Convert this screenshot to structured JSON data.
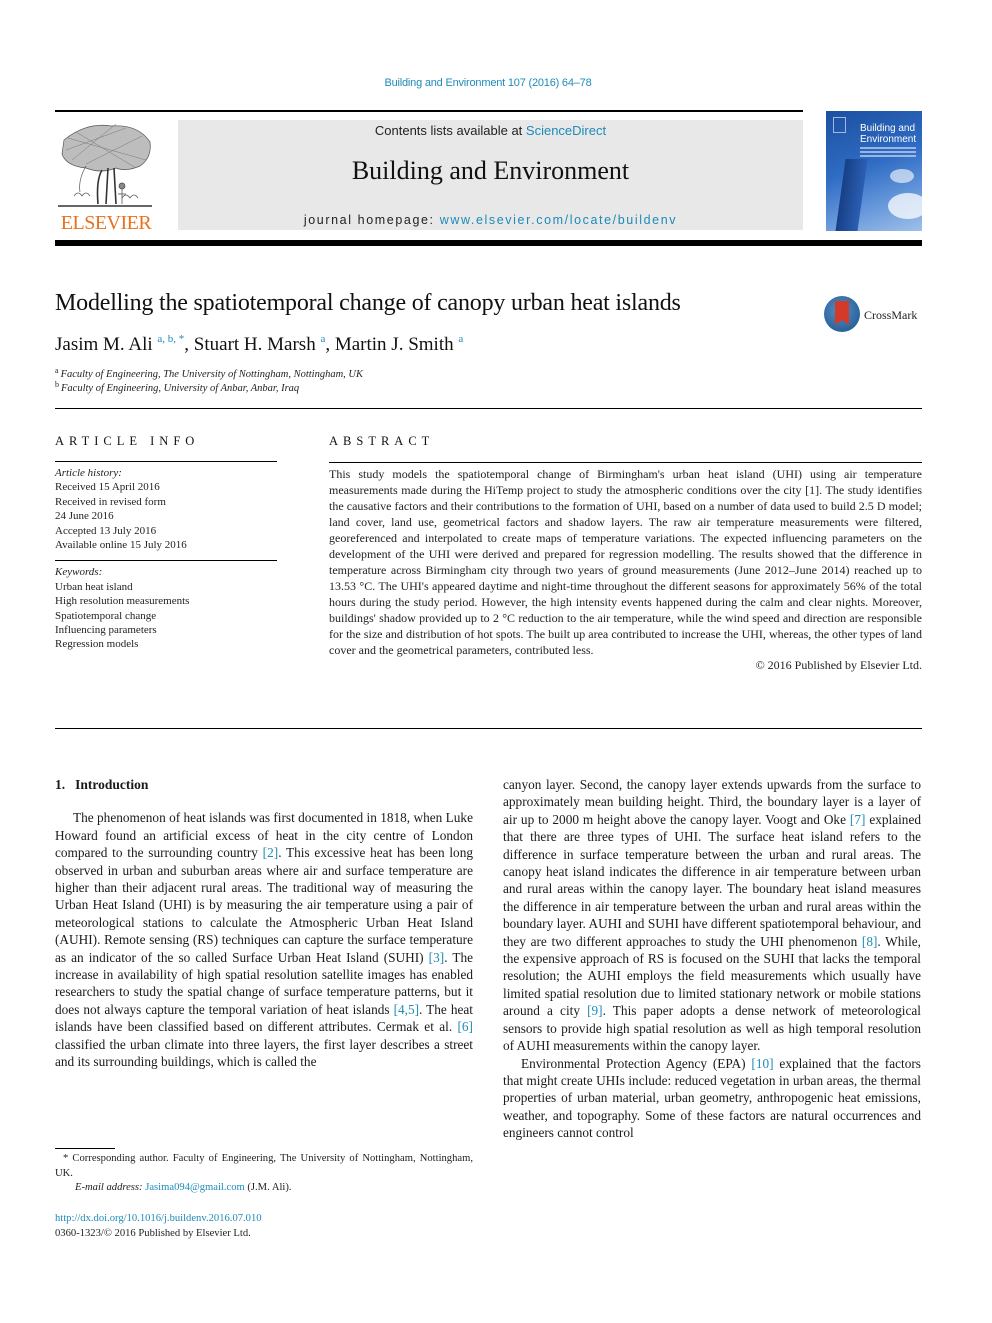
{
  "header": {
    "journal_ref": "Building and Environment 107 (2016) 64–78",
    "contents_prefix": "Contents lists available at ",
    "contents_link": "ScienceDirect",
    "journal_title": "Building and Environment",
    "homepage_prefix": "journal homepage: ",
    "homepage_link": "www.elsevier.com/locate/buildenv",
    "publisher_logo_text": "ELSEVIER",
    "cover_title_line1": "Building and",
    "cover_title_line2": "Environment",
    "colors": {
      "link": "#1f8ab8",
      "elsevier_orange": "#e9711c",
      "masthead_bg": "#e8e8e8"
    }
  },
  "article": {
    "title": "Modelling the spatiotemporal change of canopy urban heat islands",
    "crossmark_label": "CrossMark",
    "authors": [
      {
        "name": "Jasim M. Ali",
        "marks": "a, b, *",
        "sep": ", "
      },
      {
        "name": "Stuart H. Marsh",
        "marks": "a",
        "sep": ", "
      },
      {
        "name": "Martin J. Smith",
        "marks": "a",
        "sep": ""
      }
    ],
    "affiliations": [
      {
        "mark": "a",
        "text": "Faculty of Engineering, The University of Nottingham, Nottingham, UK"
      },
      {
        "mark": "b",
        "text": "Faculty of Engineering, University of Anbar, Anbar, Iraq"
      }
    ]
  },
  "article_info": {
    "heading": "ARTICLE INFO",
    "history_label": "Article history:",
    "history": [
      "Received 15 April 2016",
      "Received in revised form",
      "24 June 2016",
      "Accepted 13 July 2016",
      "Available online 15 July 2016"
    ],
    "keywords_label": "Keywords:",
    "keywords": [
      "Urban heat island",
      "High resolution measurements",
      "Spatiotemporal change",
      "Influencing parameters",
      "Regression models"
    ]
  },
  "abstract": {
    "heading": "ABSTRACT",
    "text": "This study models the spatiotemporal change of Birmingham's urban heat island (UHI) using air temperature measurements made during the HiTemp project to study the atmospheric conditions over the city [1]. The study identifies the causative factors and their contributions to the formation of UHI, based on a number of data used to build 2.5 D model; land cover, land use, geometrical factors and shadow layers. The raw air temperature measurements were filtered, georeferenced and interpolated to create maps of temperature variations. The expected influencing parameters on the development of the UHI were derived and prepared for regression modelling. The results showed that the difference in temperature across Birmingham city through two years of ground measurements (June 2012–June 2014) reached up to 13.53 °C. The UHI's appeared daytime and night-time throughout the different seasons for approximately 56% of the total hours during the study period. However, the high intensity events happened during the calm and clear nights. Moreover, buildings' shadow provided up to 2 °C reduction to the air temperature, while the wind speed and direction are responsible for the size and distribution of hot spots. The built up area contributed to increase the UHI, whereas, the other types of land cover and the geometrical parameters, contributed less.",
    "copyright": "© 2016 Published by Elsevier Ltd."
  },
  "body": {
    "section_number": "1.",
    "section_title": "Introduction",
    "left_col": [
      {
        "t": "The phenomenon of heat islands was first documented in 1818, when Luke Howard found an artificial excess of heat in the city centre of London compared to the surrounding country "
      },
      {
        "ref": "[2]"
      },
      {
        "t": ". This excessive heat has been long observed in urban and suburban areas where air and surface temperature are higher than their adjacent rural areas. The traditional way of measuring the Urban Heat Island (UHI) is by measuring the air temperature using a pair of meteorological stations to calculate the Atmospheric Urban Heat Island (AUHI). Remote sensing (RS) techniques can capture the surface temperature as an indicator of the so called Surface Urban Heat Island (SUHI) "
      },
      {
        "ref": "[3]"
      },
      {
        "t": ". The increase in availability of high spatial resolution satellite images has enabled researchers to study the spatial change of surface temperature patterns, but it does not always capture the temporal variation of heat islands "
      },
      {
        "ref": "[4,5]"
      },
      {
        "t": ". The heat islands have been classified based on different attributes. Cermak et al. "
      },
      {
        "ref": "[6]"
      },
      {
        "t": " classified the urban climate into three layers, the first layer describes a street and its surrounding buildings, which is called the"
      }
    ],
    "right_col_p1": [
      {
        "t": "canyon layer. Second, the canopy layer extends upwards from the surface to approximately mean building height. Third, the boundary layer is a layer of air up to 2000 m height above the canopy layer. Voogt and Oke "
      },
      {
        "ref": "[7]"
      },
      {
        "t": " explained that there are three types of UHI. The surface heat island refers to the difference in surface temperature between the urban and rural areas. The canopy heat island indicates the difference in air temperature between urban and rural areas within the canopy layer. The boundary heat island measures the difference in air temperature between the urban and rural areas within the boundary layer. AUHI and SUHI have different spatiotemporal behaviour, and they are two different approaches to study the UHI phenomenon "
      },
      {
        "ref": "[8]"
      },
      {
        "t": ". While, the expensive approach of RS is focused on the SUHI that lacks the temporal resolution; the AUHI employs the field measurements which usually have limited spatial resolution due to limited stationary network or mobile stations around a city "
      },
      {
        "ref": "[9]"
      },
      {
        "t": ". This paper adopts a dense network of meteorological sensors to provide high spatial resolution as well as high temporal resolution of AUHI measurements within the canopy layer."
      }
    ],
    "right_col_p2": [
      {
        "t": "Environmental Protection Agency (EPA) "
      },
      {
        "ref": "[10]"
      },
      {
        "t": " explained that the factors that might create UHIs include: reduced vegetation in urban areas, the thermal properties of urban material, urban geometry, anthropogenic heat emissions, weather, and topography. Some of these factors are natural occurrences and engineers cannot control"
      }
    ]
  },
  "footnotes": {
    "corresponding": "* Corresponding author. Faculty of Engineering, The University of Nottingham, Nottingham, UK.",
    "email_label": "E-mail address: ",
    "email": "Jasima094@gmail.com",
    "email_suffix": " (J.M. Ali).",
    "doi": "http://dx.doi.org/10.1016/j.buildenv.2016.07.010",
    "issn": "0360-1323/© 2016 Published by Elsevier Ltd."
  }
}
